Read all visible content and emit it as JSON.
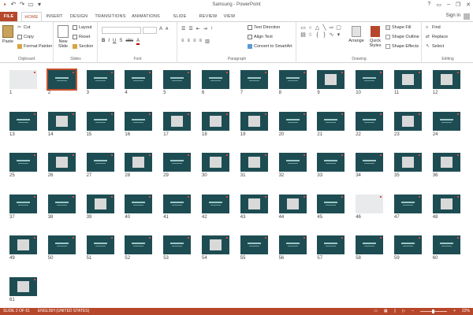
{
  "titlebar": {
    "title": "Samsung - PowerPoint",
    "qat": [
      "save-icon",
      "undo-icon",
      "redo-icon",
      "start-from-beginning-icon",
      "customize-icon"
    ],
    "help": "?",
    "minimize": "–",
    "restore": "❐",
    "close": "✕",
    "sign_in": "Sign in"
  },
  "tabs": [
    {
      "id": "file",
      "label": "FILE"
    },
    {
      "id": "home",
      "label": "HOME"
    },
    {
      "id": "insert",
      "label": "INSERT"
    },
    {
      "id": "design",
      "label": "DESIGN"
    },
    {
      "id": "transitions",
      "label": "TRANSITIONS"
    },
    {
      "id": "animations",
      "label": "ANIMATIONS"
    },
    {
      "id": "slideshow",
      "label": "SLIDE SHOW"
    },
    {
      "id": "review",
      "label": "REVIEW"
    },
    {
      "id": "view",
      "label": "VIEW"
    }
  ],
  "ribbon": {
    "clipboard": {
      "label": "Clipboard",
      "paste": "Paste",
      "cut": "Cut",
      "copy": "Copy",
      "format_painter": "Format Painter"
    },
    "slides": {
      "label": "Slides",
      "new_slide": "New Slide",
      "layout": "Layout",
      "reset": "Reset",
      "section": "Section"
    },
    "font": {
      "label": "Font",
      "bold": "B",
      "italic": "I",
      "underline": "U",
      "strike": "S",
      "shadow": "abc",
      "size_up": "A",
      "size_down": "A"
    },
    "paragraph": {
      "label": "Paragraph",
      "text_direction": "Text Direction",
      "align_text": "Align Text",
      "convert_smartart": "Convert to SmartArt"
    },
    "drawing": {
      "label": "Drawing",
      "arrange": "Arrange",
      "quick_styles": "Quick Styles",
      "shape_fill": "Shape Fill",
      "shape_outline": "Shape Outline",
      "shape_effects": "Shape Effects"
    },
    "editing": {
      "label": "Editing",
      "find": "Find",
      "replace": "Replace",
      "select": "Select"
    }
  },
  "slides": [
    {
      "n": "1"
    },
    {
      "n": "2"
    },
    {
      "n": "3"
    },
    {
      "n": "4"
    },
    {
      "n": "5"
    },
    {
      "n": "6"
    },
    {
      "n": "7"
    },
    {
      "n": "8"
    },
    {
      "n": "9"
    },
    {
      "n": "10"
    },
    {
      "n": "11"
    },
    {
      "n": "12"
    },
    {
      "n": "13"
    },
    {
      "n": "14"
    },
    {
      "n": "15"
    },
    {
      "n": "16"
    },
    {
      "n": "17"
    },
    {
      "n": "18"
    },
    {
      "n": "19"
    },
    {
      "n": "20"
    },
    {
      "n": "21"
    },
    {
      "n": "22"
    },
    {
      "n": "23"
    },
    {
      "n": "24"
    },
    {
      "n": "25"
    },
    {
      "n": "26"
    },
    {
      "n": "27"
    },
    {
      "n": "28"
    },
    {
      "n": "29"
    },
    {
      "n": "30"
    },
    {
      "n": "31"
    },
    {
      "n": "32"
    },
    {
      "n": "33"
    },
    {
      "n": "34"
    },
    {
      "n": "35"
    },
    {
      "n": "36"
    },
    {
      "n": "37"
    },
    {
      "n": "38"
    },
    {
      "n": "39"
    },
    {
      "n": "40"
    },
    {
      "n": "41"
    },
    {
      "n": "42"
    },
    {
      "n": "43"
    },
    {
      "n": "44"
    },
    {
      "n": "45"
    },
    {
      "n": "46"
    },
    {
      "n": "47"
    },
    {
      "n": "48"
    },
    {
      "n": "49"
    },
    {
      "n": "50"
    },
    {
      "n": "51"
    },
    {
      "n": "52"
    },
    {
      "n": "53"
    },
    {
      "n": "54"
    },
    {
      "n": "55"
    },
    {
      "n": "56"
    },
    {
      "n": "57"
    },
    {
      "n": "58"
    },
    {
      "n": "59"
    },
    {
      "n": "60"
    },
    {
      "n": "61"
    }
  ],
  "selected_slide": "2",
  "statusbar": {
    "slide_info": "SLIDE 2 OF 61",
    "language": "ENGLISH (UNITED STATES)",
    "zoom": "22%"
  },
  "colors": {
    "accent": "#b7472a",
    "slide_bg": "#1d4d52",
    "selection": "#c8502d"
  }
}
